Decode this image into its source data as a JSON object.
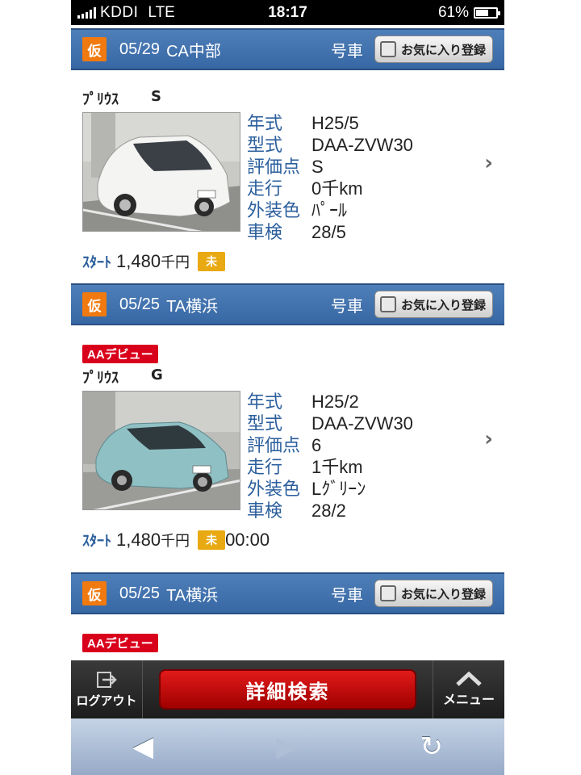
{
  "status_bar": {
    "carrier": "KDDI",
    "network": "LTE",
    "time": "18:17",
    "battery": "61%",
    "battery_level": 0.61
  },
  "lots": [
    {
      "kari": "仮",
      "date": "05/29",
      "venue": "CA中部",
      "car_no": "号車",
      "fav_label": "お気に入り登録"
    },
    {
      "kari": "仮",
      "date": "05/25",
      "venue": "TA横浜",
      "car_no": "号車",
      "fav_label": "お気に入り登録"
    },
    {
      "kari": "仮",
      "date": "05/25",
      "venue": "TA横浜",
      "car_no": "号車",
      "fav_label": "お気に入り登録"
    }
  ],
  "listings": [
    {
      "model": "ﾌﾟﾘｳｽ",
      "grade": "S",
      "specs": [
        {
          "key": "年式",
          "value": "H25/5"
        },
        {
          "key": "型式",
          "value": "DAA-ZVW30"
        },
        {
          "key": "評価点",
          "value": "S"
        },
        {
          "key": "走行",
          "value": "0千km"
        },
        {
          "key": "外装色",
          "value": "ﾊﾟｰﾙ"
        },
        {
          "key": "車検",
          "value": "28/5"
        }
      ],
      "start_label": "ｽﾀｰﾄ",
      "price": "1,480",
      "unit": "千円",
      "status": "未",
      "time": ""
    },
    {
      "badge": "AAデビュー",
      "model": "ﾌﾟﾘｳｽ",
      "grade": "G",
      "specs": [
        {
          "key": "年式",
          "value": "H25/2"
        },
        {
          "key": "型式",
          "value": "DAA-ZVW30"
        },
        {
          "key": "評価点",
          "value": "6"
        },
        {
          "key": "走行",
          "value": "1千km"
        },
        {
          "key": "外装色",
          "value": "Lｸﾞﾘｰﾝ"
        },
        {
          "key": "車検",
          "value": "28/2"
        }
      ],
      "start_label": "ｽﾀｰﾄ",
      "price": "1,480",
      "unit": "千円",
      "status": "未",
      "time": "00:00"
    },
    {
      "badge": "AAデビュー"
    }
  ],
  "toolbar": {
    "logout": "ログアウト",
    "search": "詳細検索",
    "menu": "メニュー"
  },
  "icons": {
    "logout": "logout-icon",
    "menu": "chevron-up-icon",
    "back": "back-arrow-icon",
    "forward": "forward-arrow-icon",
    "reload": "reload-icon"
  }
}
